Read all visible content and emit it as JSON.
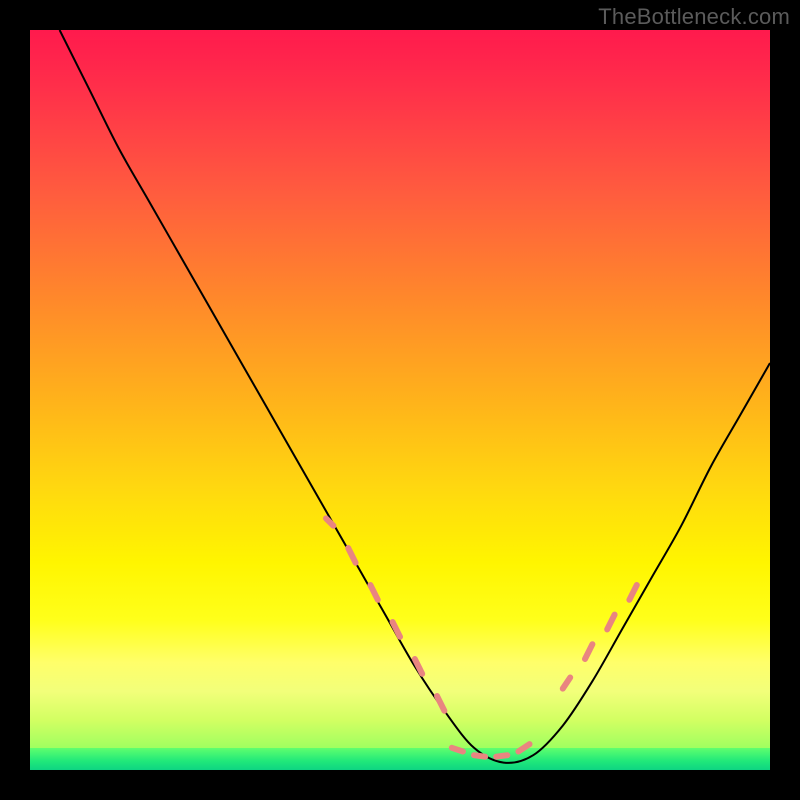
{
  "watermark": "TheBottleneck.com",
  "chart_data": {
    "type": "line",
    "title": "",
    "xlabel": "",
    "ylabel": "",
    "xlim": [
      0,
      100
    ],
    "ylim": [
      0,
      100
    ],
    "grid": false,
    "legend": false,
    "background_gradient": {
      "stops": [
        {
          "position": 0,
          "color": "#ff1a4d"
        },
        {
          "position": 22,
          "color": "#ff5a3f"
        },
        {
          "position": 52,
          "color": "#ffb41a"
        },
        {
          "position": 74,
          "color": "#fff500"
        },
        {
          "position": 92,
          "color": "#d2ff62"
        },
        {
          "position": 97,
          "color": "#5fff6e"
        },
        {
          "position": 100,
          "color": "#0ed482"
        }
      ]
    },
    "series": [
      {
        "name": "bottleneck-curve",
        "stroke": "#000000",
        "x": [
          4,
          8,
          12,
          16,
          20,
          24,
          28,
          32,
          36,
          40,
          44,
          48,
          52,
          56,
          60,
          64,
          68,
          72,
          76,
          80,
          84,
          88,
          92,
          96,
          100
        ],
        "values": [
          100,
          92,
          84,
          77,
          70,
          63,
          56,
          49,
          42,
          35,
          28,
          21,
          14,
          8,
          3,
          1,
          2,
          6,
          12,
          19,
          26,
          33,
          41,
          48,
          55
        ]
      },
      {
        "name": "highlight-dashes-left",
        "stroke": "#e57373",
        "x": [
          40,
          41,
          43,
          44,
          46,
          47,
          49,
          50,
          52,
          53,
          55,
          56
        ],
        "values": [
          34,
          33,
          30,
          28,
          25,
          23,
          20,
          18,
          15,
          13,
          10,
          8
        ]
      },
      {
        "name": "highlight-dashes-bottom",
        "stroke": "#e57373",
        "x": [
          57,
          58.5,
          60,
          61.5,
          63,
          64.5,
          66,
          67.5
        ],
        "values": [
          3,
          2.5,
          2,
          1.8,
          1.8,
          2,
          2.5,
          3.5
        ]
      },
      {
        "name": "highlight-dashes-right",
        "stroke": "#e57373",
        "x": [
          72,
          73,
          75,
          76,
          78,
          79,
          81,
          82,
          84
        ],
        "values": [
          11,
          12.5,
          15,
          17,
          19,
          21,
          23,
          25,
          27
        ]
      }
    ]
  }
}
